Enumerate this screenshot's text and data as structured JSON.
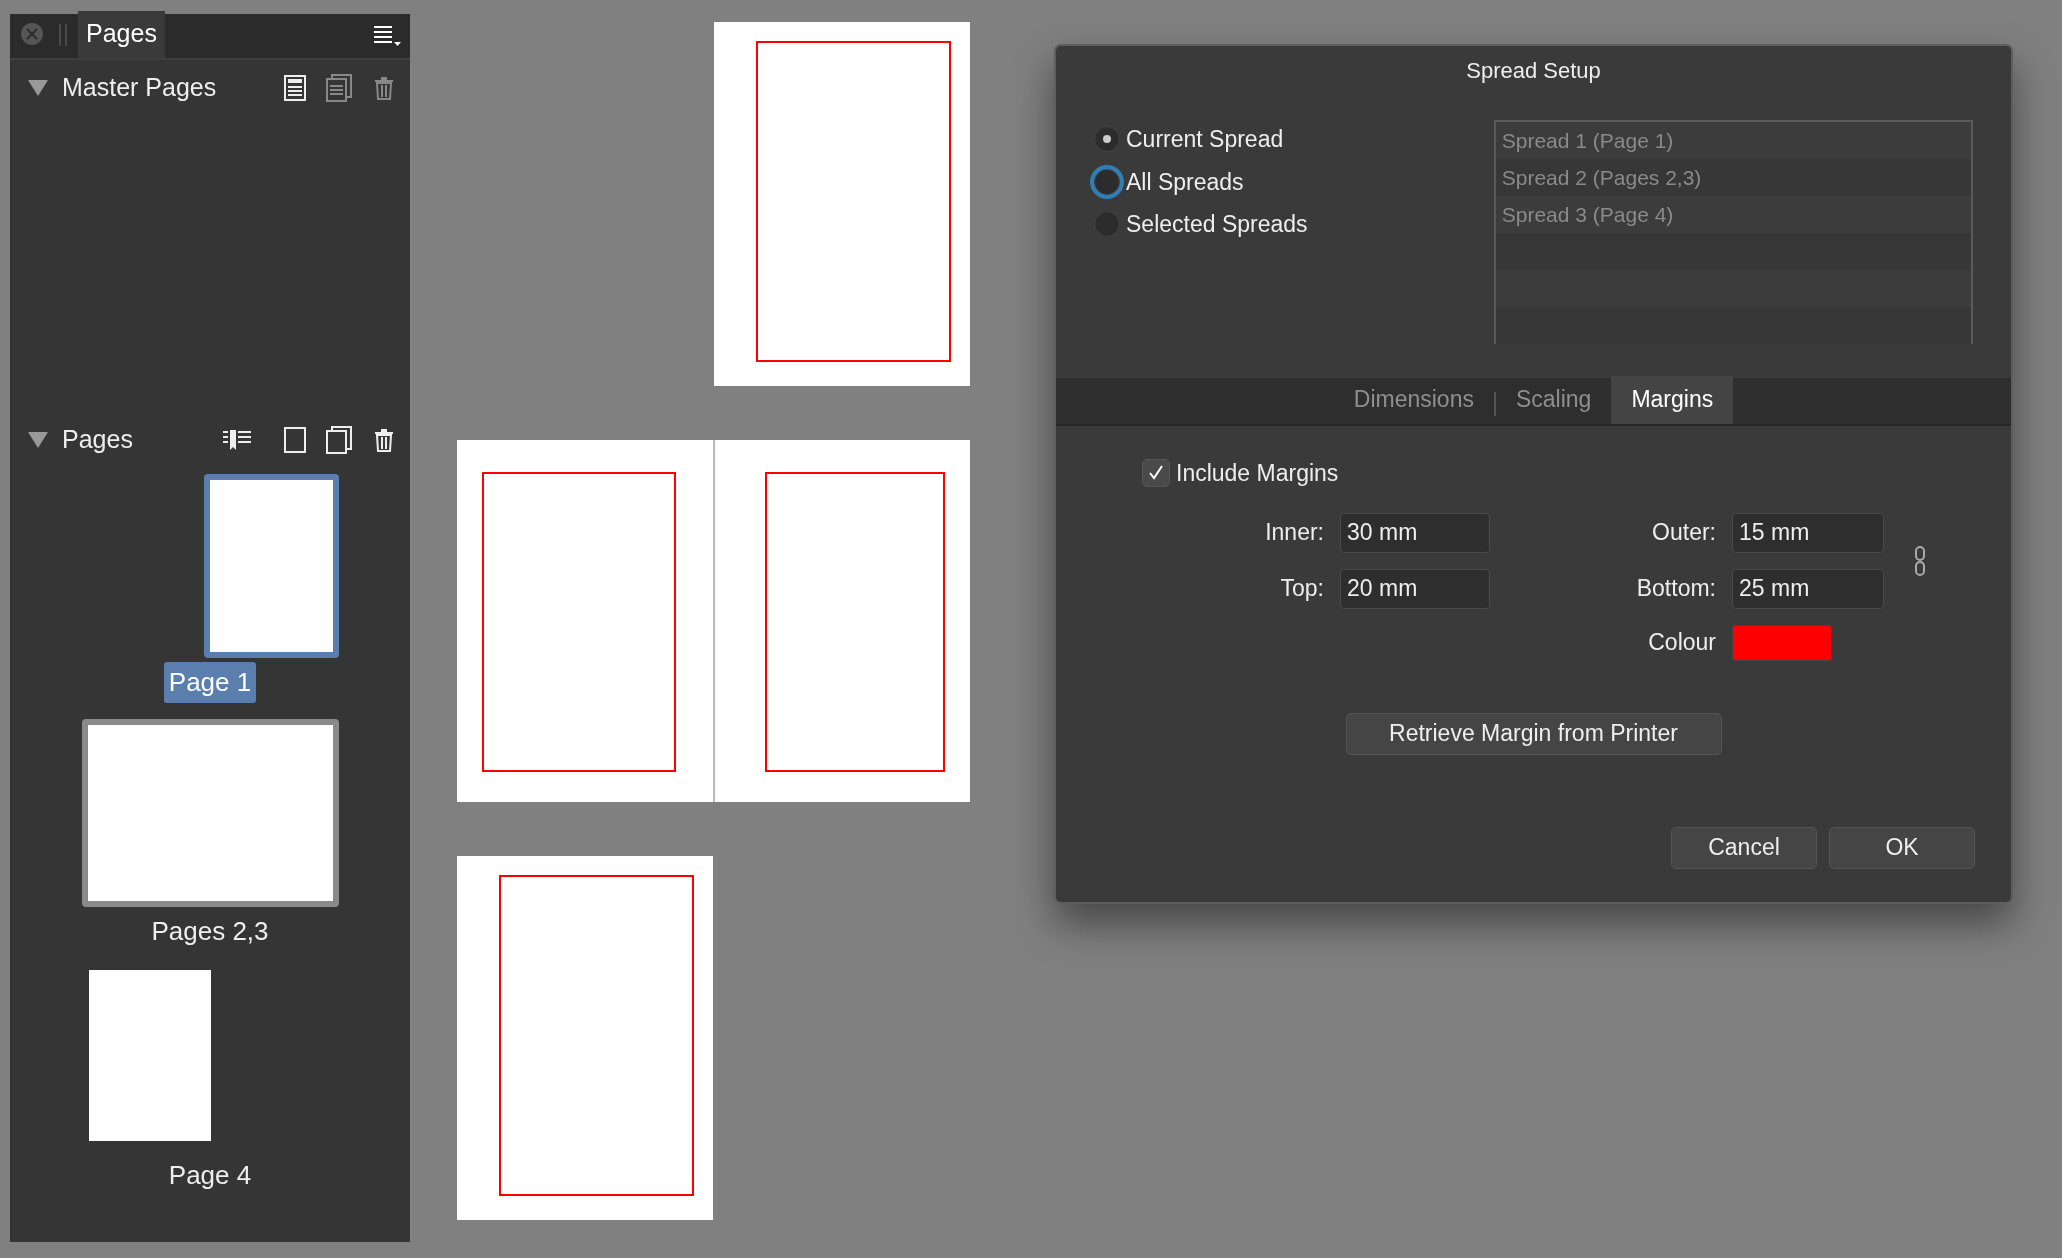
{
  "panel": {
    "tab": "Pages",
    "sections": [
      {
        "kind": "master",
        "title": "Master Pages"
      },
      {
        "kind": "pages",
        "title": "Pages"
      }
    ],
    "thumbnails": [
      {
        "label": "Page 1",
        "kind": "right",
        "selected": true
      },
      {
        "label": "Pages 2,3",
        "kind": "spread",
        "selected": false
      },
      {
        "label": "Page 4",
        "kind": "left",
        "selected": false
      }
    ]
  },
  "canvas": {
    "spreads": [
      {
        "kind": "right"
      },
      {
        "kind": "spread"
      },
      {
        "kind": "left"
      }
    ]
  },
  "dialog": {
    "title": "Spread Setup",
    "scope": [
      {
        "label": "Current Spread",
        "selected": true,
        "focused": false
      },
      {
        "label": "All Spreads",
        "selected": false,
        "focused": true
      },
      {
        "label": "Selected Spreads",
        "selected": false,
        "focused": false
      }
    ],
    "spread_list": [
      {
        "label": "Spread 1 (Page 1)",
        "disabled": true
      },
      {
        "label": "Spread 2 (Pages 2,3)",
        "disabled": true
      },
      {
        "label": "Spread 3 (Page 4)",
        "disabled": true
      }
    ],
    "tabs": [
      {
        "label": "Dimensions",
        "selected": false
      },
      {
        "label": "Scaling",
        "selected": false
      },
      {
        "label": "Margins",
        "selected": true
      }
    ],
    "include_margins": {
      "label": "Include Margins",
      "checked": true
    },
    "fields": [
      {
        "label": "Inner:",
        "value": "30 mm"
      },
      {
        "label": "Outer:",
        "value": "15 mm"
      },
      {
        "label": "Top:",
        "value": "20 mm"
      },
      {
        "label": "Bottom:",
        "value": "25 mm"
      }
    ],
    "colour": {
      "label": "Colour",
      "color": "#ff0000"
    },
    "retrieve_button": "Retrieve Margin from Printer",
    "buttons": [
      "Cancel",
      "OK"
    ]
  }
}
